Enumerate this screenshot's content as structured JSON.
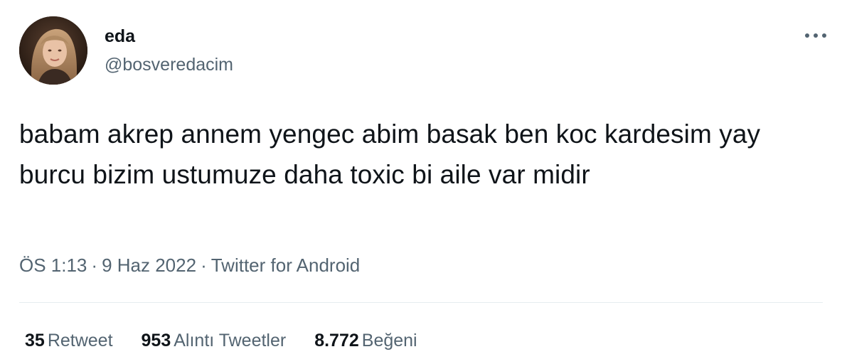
{
  "author": {
    "display_name": "eda",
    "handle": "@bosveredacim",
    "avatar_icon": "profile-photo"
  },
  "more_icon": "more-horizontal-icon",
  "tweet": {
    "text": "babam akrep annem yengec abim basak ben koc kardesim yay burcu bizim ustumuze daha toxic bi aile var midir"
  },
  "meta": {
    "time": "ÖS 1:13",
    "separator": "·",
    "date": "9 Haz 2022",
    "source": "Twitter for Android"
  },
  "stats": {
    "retweets_count": "35",
    "retweets_label": "Retweet",
    "quotes_count": "953",
    "quotes_label": "Alıntı Tweetler",
    "likes_count": "8.772",
    "likes_label": "Beğeni"
  },
  "colors": {
    "text_primary": "#0f1419",
    "text_secondary": "#536471",
    "divider": "#e6ecf0",
    "background": "#ffffff"
  }
}
